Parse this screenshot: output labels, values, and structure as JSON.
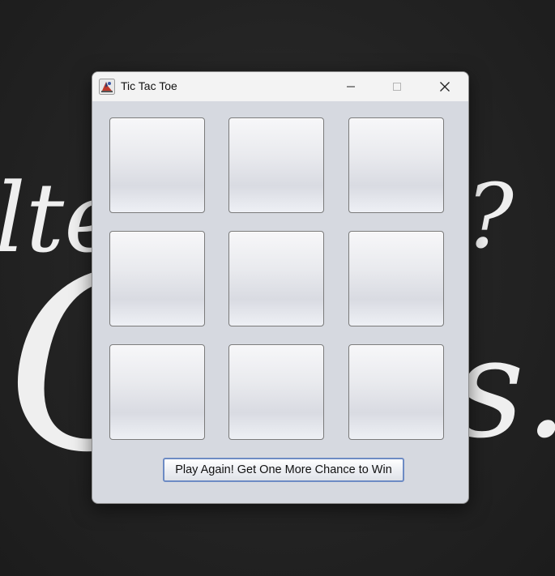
{
  "window": {
    "title": "Tic Tac Toe",
    "icon": "java-app-icon",
    "controls": {
      "minimize_icon": "minimize-icon",
      "maximize_icon": "maximize-icon",
      "close_icon": "close-icon"
    }
  },
  "board": {
    "rows": 3,
    "columns": 3,
    "cells": [
      [
        "",
        "",
        ""
      ],
      [
        "",
        "",
        ""
      ],
      [
        "",
        "",
        ""
      ]
    ]
  },
  "actions": {
    "play_again_label": "Play Again! Get One More Chance to Win"
  },
  "colors": {
    "window_background": "#d6d9e0",
    "titlebar_background": "#f3f3f3",
    "button_focus_border": "#6d8bc4",
    "desktop_background": "#262626"
  }
}
